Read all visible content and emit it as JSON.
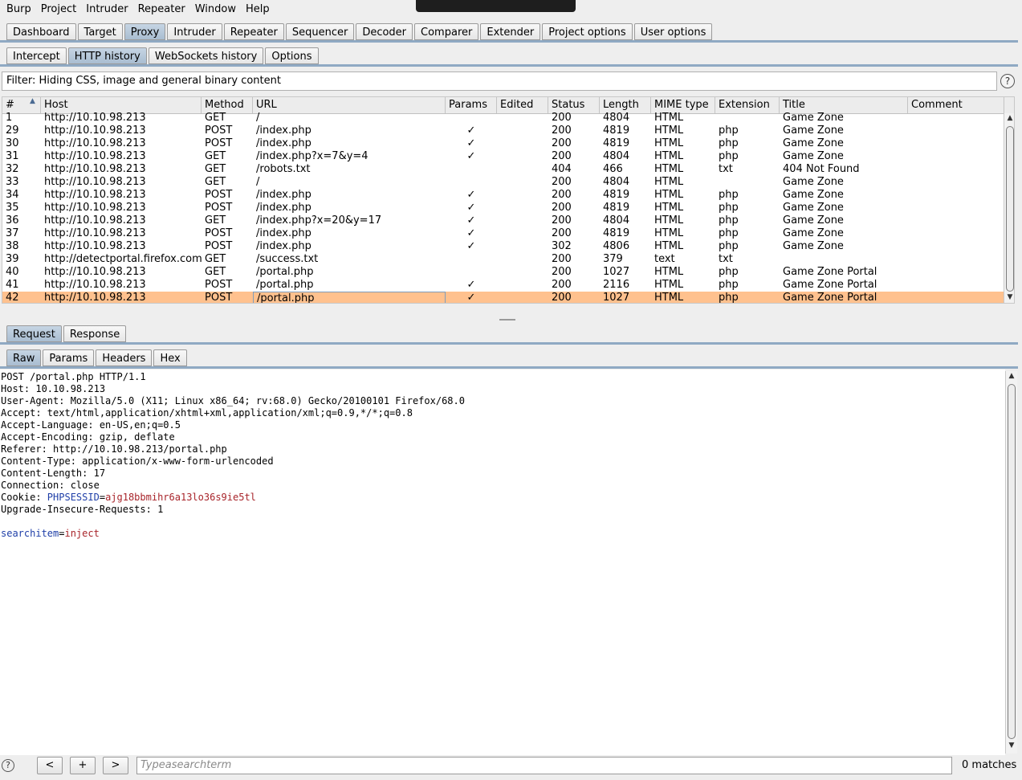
{
  "menu": [
    "Burp",
    "Project",
    "Intruder",
    "Repeater",
    "Window",
    "Help"
  ],
  "main_tabs": [
    {
      "label": "Dashboard",
      "active": false
    },
    {
      "label": "Target",
      "active": false
    },
    {
      "label": "Proxy",
      "active": true
    },
    {
      "label": "Intruder",
      "active": false
    },
    {
      "label": "Repeater",
      "active": false
    },
    {
      "label": "Sequencer",
      "active": false
    },
    {
      "label": "Decoder",
      "active": false
    },
    {
      "label": "Comparer",
      "active": false
    },
    {
      "label": "Extender",
      "active": false
    },
    {
      "label": "Project options",
      "active": false
    },
    {
      "label": "User options",
      "active": false
    }
  ],
  "proxy_tabs": [
    {
      "label": "Intercept",
      "active": false
    },
    {
      "label": "HTTP history",
      "active": true
    },
    {
      "label": "WebSockets history",
      "active": false
    },
    {
      "label": "Options",
      "active": false
    }
  ],
  "filter": {
    "text": "Filter: Hiding CSS, image and general binary content",
    "help": "?"
  },
  "history_table": {
    "columns": [
      "#",
      "Host",
      "Method",
      "URL",
      "Params",
      "Edited",
      "Status",
      "Length",
      "MIME type",
      "Extension",
      "Title",
      "Comment"
    ],
    "sort_indicator": "▲",
    "check": "✓",
    "rows": [
      {
        "id": "1",
        "host": "http://10.10.98.213",
        "method": "GET",
        "url": "/",
        "params": false,
        "status": "200",
        "length": "4804",
        "mime": "HTML",
        "ext": "",
        "title": "Game Zone"
      },
      {
        "id": "29",
        "host": "http://10.10.98.213",
        "method": "POST",
        "url": "/index.php",
        "params": true,
        "status": "200",
        "length": "4819",
        "mime": "HTML",
        "ext": "php",
        "title": "Game Zone"
      },
      {
        "id": "30",
        "host": "http://10.10.98.213",
        "method": "POST",
        "url": "/index.php",
        "params": true,
        "status": "200",
        "length": "4819",
        "mime": "HTML",
        "ext": "php",
        "title": "Game Zone"
      },
      {
        "id": "31",
        "host": "http://10.10.98.213",
        "method": "GET",
        "url": "/index.php?x=7&y=4",
        "params": true,
        "status": "200",
        "length": "4804",
        "mime": "HTML",
        "ext": "php",
        "title": "Game Zone"
      },
      {
        "id": "32",
        "host": "http://10.10.98.213",
        "method": "GET",
        "url": "/robots.txt",
        "params": false,
        "status": "404",
        "length": "466",
        "mime": "HTML",
        "ext": "txt",
        "title": "404 Not Found"
      },
      {
        "id": "33",
        "host": "http://10.10.98.213",
        "method": "GET",
        "url": "/",
        "params": false,
        "status": "200",
        "length": "4804",
        "mime": "HTML",
        "ext": "",
        "title": "Game Zone"
      },
      {
        "id": "34",
        "host": "http://10.10.98.213",
        "method": "POST",
        "url": "/index.php",
        "params": true,
        "status": "200",
        "length": "4819",
        "mime": "HTML",
        "ext": "php",
        "title": "Game Zone"
      },
      {
        "id": "35",
        "host": "http://10.10.98.213",
        "method": "POST",
        "url": "/index.php",
        "params": true,
        "status": "200",
        "length": "4819",
        "mime": "HTML",
        "ext": "php",
        "title": "Game Zone"
      },
      {
        "id": "36",
        "host": "http://10.10.98.213",
        "method": "GET",
        "url": "/index.php?x=20&y=17",
        "params": true,
        "status": "200",
        "length": "4804",
        "mime": "HTML",
        "ext": "php",
        "title": "Game Zone"
      },
      {
        "id": "37",
        "host": "http://10.10.98.213",
        "method": "POST",
        "url": "/index.php",
        "params": true,
        "status": "200",
        "length": "4819",
        "mime": "HTML",
        "ext": "php",
        "title": "Game Zone"
      },
      {
        "id": "38",
        "host": "http://10.10.98.213",
        "method": "POST",
        "url": "/index.php",
        "params": true,
        "status": "302",
        "length": "4806",
        "mime": "HTML",
        "ext": "php",
        "title": "Game Zone"
      },
      {
        "id": "39",
        "host": "http://detectportal.firefox.com",
        "method": "GET",
        "url": "/success.txt",
        "params": false,
        "status": "200",
        "length": "379",
        "mime": "text",
        "ext": "txt",
        "title": ""
      },
      {
        "id": "40",
        "host": "http://10.10.98.213",
        "method": "GET",
        "url": "/portal.php",
        "params": false,
        "status": "200",
        "length": "1027",
        "mime": "HTML",
        "ext": "php",
        "title": "Game Zone Portal"
      },
      {
        "id": "41",
        "host": "http://10.10.98.213",
        "method": "POST",
        "url": "/portal.php",
        "params": true,
        "status": "200",
        "length": "2116",
        "mime": "HTML",
        "ext": "php",
        "title": "Game Zone Portal"
      },
      {
        "id": "42",
        "host": "http://10.10.98.213",
        "method": "POST",
        "url": "/portal.php",
        "params": true,
        "status": "200",
        "length": "1027",
        "mime": "HTML",
        "ext": "php",
        "title": "Game Zone Portal",
        "selected": true
      }
    ]
  },
  "reqresp_tabs": [
    {
      "label": "Request",
      "active": true
    },
    {
      "label": "Response",
      "active": false
    }
  ],
  "view_tabs": [
    {
      "label": "Raw",
      "active": true
    },
    {
      "label": "Params",
      "active": false
    },
    {
      "label": "Headers",
      "active": false
    },
    {
      "label": "Hex",
      "active": false
    }
  ],
  "request": {
    "lines": [
      "POST /portal.php HTTP/1.1",
      "Host: 10.10.98.213",
      "User-Agent: Mozilla/5.0 (X11; Linux x86_64; rv:68.0) Gecko/20100101 Firefox/68.0",
      "Accept: text/html,application/xhtml+xml,application/xml;q=0.9,*/*;q=0.8",
      "Accept-Language: en-US,en;q=0.5",
      "Accept-Encoding: gzip, deflate",
      "Referer: http://10.10.98.213/portal.php",
      "Content-Type: application/x-www-form-urlencoded",
      "Content-Length: 17",
      "Connection: close"
    ],
    "cookie_prefix": "Cookie: ",
    "cookie_name": "PHPSESSID",
    "cookie_eq": "=",
    "cookie_value": "ajg18bbmihr6a13lo36s9ie5tl",
    "upgrade_line": "Upgrade-Insecure-Requests: 1",
    "body_param": "searchitem",
    "body_eq": "=",
    "body_value": "inject"
  },
  "bottom_bar": {
    "help": "?",
    "prev": "<",
    "add": "+",
    "next": ">",
    "search_placeholder": "Typeasearchterm",
    "matches": "0 matches"
  },
  "colors": {
    "selected_row": "#ffc18e",
    "active_tab": "#b5c7d9",
    "cookie_key": "#1f3fa8",
    "cookie_value": "#a8242a"
  }
}
